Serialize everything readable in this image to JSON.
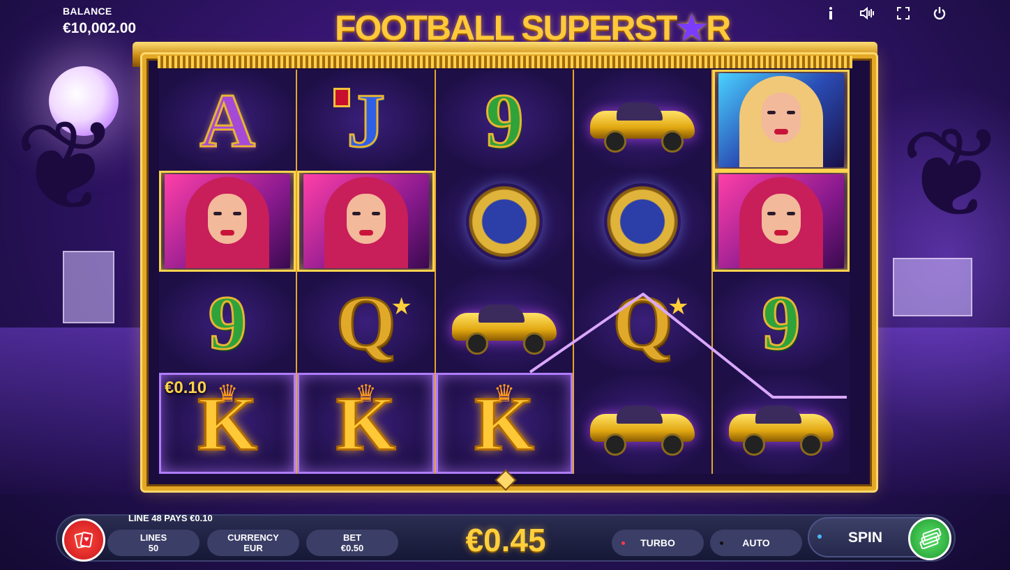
{
  "header": {
    "balance_label": "BALANCE",
    "balance_value": "€10,002.00",
    "title_main": "FOOTBALL SUPERST",
    "title_star": "★",
    "title_end": "R",
    "icons": [
      "info-icon",
      "sound-icon",
      "fullscreen-icon",
      "power-icon"
    ]
  },
  "reels": [
    [
      {
        "type": "letter",
        "value": "A",
        "style": "A",
        "win": ""
      },
      {
        "type": "portrait",
        "variant": "pink",
        "win": "gold"
      },
      {
        "type": "letter",
        "value": "9",
        "style": "9",
        "win": ""
      },
      {
        "type": "letter",
        "value": "K",
        "style": "K",
        "win": "purple",
        "amount": "€0.10"
      }
    ],
    [
      {
        "type": "letter",
        "value": "J",
        "style": "J",
        "win": ""
      },
      {
        "type": "portrait",
        "variant": "pink",
        "win": "gold"
      },
      {
        "type": "letter",
        "value": "Q",
        "style": "Q",
        "win": ""
      },
      {
        "type": "letter",
        "value": "K",
        "style": "K",
        "win": "purple"
      }
    ],
    [
      {
        "type": "letter",
        "value": "9",
        "style": "9",
        "win": ""
      },
      {
        "type": "watch",
        "win": ""
      },
      {
        "type": "car",
        "win": ""
      },
      {
        "type": "letter",
        "value": "K",
        "style": "K",
        "win": "purple"
      }
    ],
    [
      {
        "type": "car",
        "win": ""
      },
      {
        "type": "watch",
        "win": ""
      },
      {
        "type": "letter",
        "value": "Q",
        "style": "Q",
        "win": ""
      },
      {
        "type": "car",
        "win": ""
      }
    ],
    [
      {
        "type": "portrait",
        "variant": "blonde",
        "win": "gold"
      },
      {
        "type": "portrait",
        "variant": "pink",
        "win": "gold"
      },
      {
        "type": "letter",
        "value": "9",
        "style": "9",
        "win": ""
      },
      {
        "type": "car",
        "win": ""
      }
    ]
  ],
  "bottom": {
    "line_message": "LINE 48 PAYS €0.10",
    "lines_label": "LINES",
    "lines_value": "50",
    "currency_label": "CURRENCY",
    "currency_value": "EUR",
    "bet_label": "BET",
    "bet_value": "€0.50",
    "total_bet": "€0.45",
    "turbo_label": "TURBO",
    "auto_label": "AUTO",
    "spin_label": "SPIN"
  },
  "colors": {
    "gold": "#ffcf3d",
    "turbo_dot": "#ff3a4a",
    "auto_dot": "#111111",
    "spin_dot": "#4ab8ff",
    "payline": "#d9a7ff"
  }
}
